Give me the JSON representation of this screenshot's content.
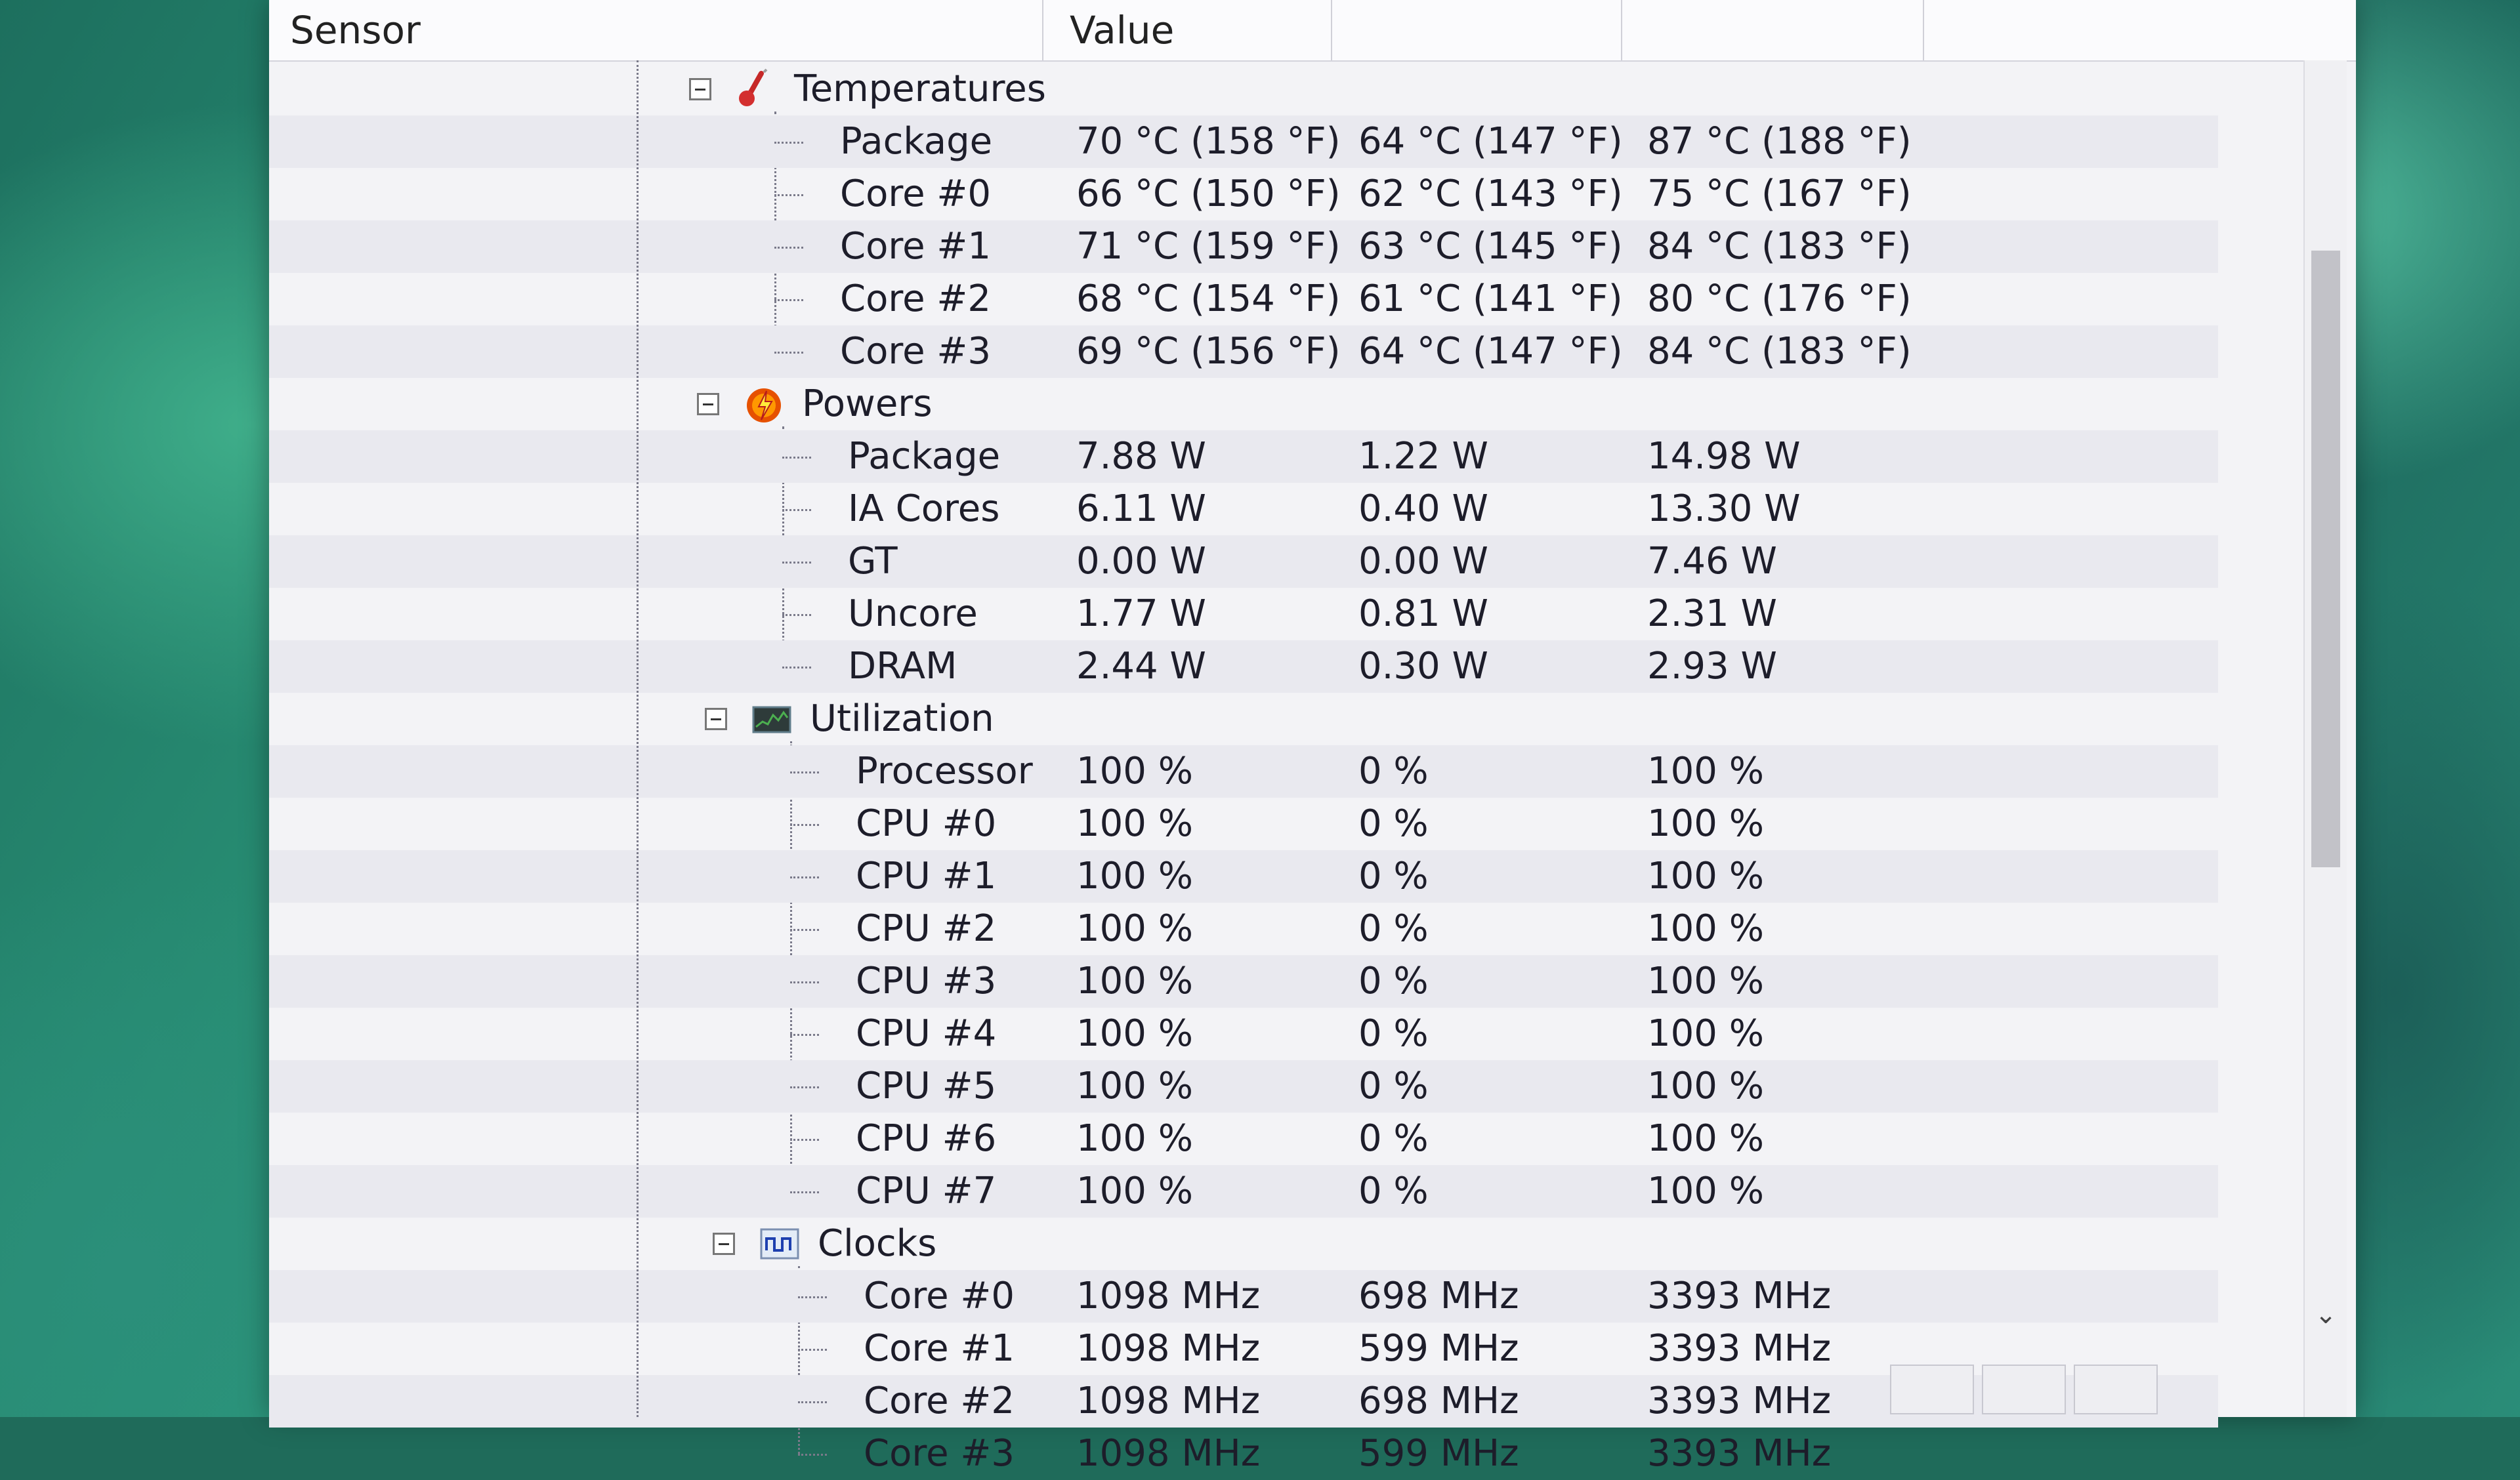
{
  "columns": {
    "sensor": "Sensor",
    "value": "Value",
    "min": "",
    "max": ""
  },
  "groups": [
    {
      "name": "Temperatures",
      "icon": "thermometer-icon",
      "rows": [
        {
          "label": "Package",
          "value": "70 °C  (158 °F)",
          "min": "64 °C  (147 °F)",
          "max": "87 °C  (188 °F)"
        },
        {
          "label": "Core #0",
          "value": "66 °C  (150 °F)",
          "min": "62 °C  (143 °F)",
          "max": "75 °C  (167 °F)"
        },
        {
          "label": "Core #1",
          "value": "71 °C  (159 °F)",
          "min": "63 °C  (145 °F)",
          "max": "84 °C  (183 °F)"
        },
        {
          "label": "Core #2",
          "value": "68 °C  (154 °F)",
          "min": "61 °C  (141 °F)",
          "max": "80 °C  (176 °F)"
        },
        {
          "label": "Core #3",
          "value": "69 °C  (156 °F)",
          "min": "64 °C  (147 °F)",
          "max": "84 °C  (183 °F)"
        }
      ]
    },
    {
      "name": "Powers",
      "icon": "power-flame-icon",
      "rows": [
        {
          "label": "Package",
          "value": "7.88 W",
          "min": "1.22 W",
          "max": "14.98 W"
        },
        {
          "label": "IA Cores",
          "value": "6.11 W",
          "min": "0.40 W",
          "max": "13.30 W"
        },
        {
          "label": "GT",
          "value": "0.00 W",
          "min": "0.00 W",
          "max": "7.46 W"
        },
        {
          "label": "Uncore",
          "value": "1.77 W",
          "min": "0.81 W",
          "max": "2.31 W"
        },
        {
          "label": "DRAM",
          "value": "2.44 W",
          "min": "0.30 W",
          "max": "2.93 W"
        }
      ]
    },
    {
      "name": "Utilization",
      "icon": "utilization-graph-icon",
      "rows": [
        {
          "label": "Processor",
          "value": "100 %",
          "min": "0 %",
          "max": "100 %"
        },
        {
          "label": "CPU #0",
          "value": "100 %",
          "min": "0 %",
          "max": "100 %"
        },
        {
          "label": "CPU #1",
          "value": "100 %",
          "min": "0 %",
          "max": "100 %"
        },
        {
          "label": "CPU #2",
          "value": "100 %",
          "min": "0 %",
          "max": "100 %"
        },
        {
          "label": "CPU #3",
          "value": "100 %",
          "min": "0 %",
          "max": "100 %"
        },
        {
          "label": "CPU #4",
          "value": "100 %",
          "min": "0 %",
          "max": "100 %"
        },
        {
          "label": "CPU #5",
          "value": "100 %",
          "min": "0 %",
          "max": "100 %"
        },
        {
          "label": "CPU #6",
          "value": "100 %",
          "min": "0 %",
          "max": "100 %"
        },
        {
          "label": "CPU #7",
          "value": "100 %",
          "min": "0 %",
          "max": "100 %"
        }
      ]
    },
    {
      "name": "Clocks",
      "icon": "clock-wave-icon",
      "rows": [
        {
          "label": "Core #0",
          "value": "1098 MHz",
          "min": "698 MHz",
          "max": "3393 MHz"
        },
        {
          "label": "Core #1",
          "value": "1098 MHz",
          "min": "599 MHz",
          "max": "3393 MHz"
        },
        {
          "label": "Core #2",
          "value": "1098 MHz",
          "min": "698 MHz",
          "max": "3393 MHz"
        },
        {
          "label": "Core #3",
          "value": "1098 MHz",
          "min": "599 MHz",
          "max": "3393 MHz"
        }
      ]
    }
  ],
  "colors": {
    "row_alt": "#e9e9ef",
    "background": "#f3f3f6",
    "text": "#1d1d2a"
  }
}
